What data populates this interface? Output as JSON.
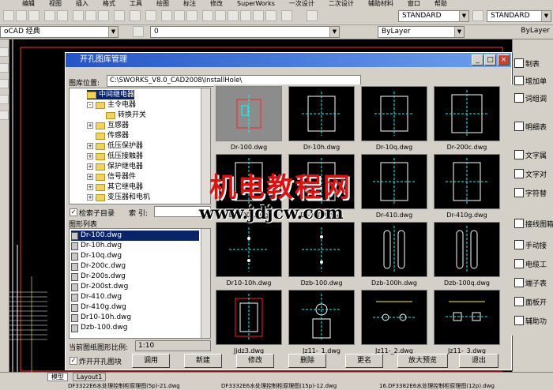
{
  "menubar": {
    "items": [
      "编辑",
      "视图",
      "插入",
      "格式",
      "工具",
      "绘图",
      "标注",
      "修改",
      "SuperWorks",
      "一次设计",
      "二次设计",
      "辅助材料",
      "窗口",
      "帮助"
    ]
  },
  "toolbar": {
    "style1": "STANDARD",
    "style2": "STANDARD"
  },
  "toolbar2": {
    "workspace": "oCAD 经典",
    "layer": "0",
    "color": "ByLayer",
    "linetype": "ByLayer"
  },
  "dialog": {
    "title": "开孔图库管理",
    "path_label": "图库位置:",
    "path_value": "C:\\SWORKS_V8.0_CAD2008\\InstallHole\\",
    "tree": [
      {
        "label": "中间继电器",
        "level": 1,
        "expander": "",
        "selected": true
      },
      {
        "label": "主令电器",
        "level": 1,
        "expander": "-",
        "selected": false
      },
      {
        "label": "转换开关",
        "level": 2,
        "expander": "",
        "selected": false
      },
      {
        "label": "互感器",
        "level": 1,
        "expander": "+",
        "selected": false
      },
      {
        "label": "传感器",
        "level": 1,
        "expander": "",
        "selected": false
      },
      {
        "label": "低压保护器",
        "level": 1,
        "expander": "+",
        "selected": false
      },
      {
        "label": "低压接触器",
        "level": 1,
        "expander": "+",
        "selected": false
      },
      {
        "label": "保护继电器",
        "level": 1,
        "expander": "+",
        "selected": false
      },
      {
        "label": "信号器件",
        "level": 1,
        "expander": "+",
        "selected": false
      },
      {
        "label": "其它继电器",
        "level": 1,
        "expander": "+",
        "selected": false
      },
      {
        "label": "变压器和电机",
        "level": 1,
        "expander": "+",
        "selected": false
      }
    ],
    "search_sub_label": "检索子目录",
    "search_label": "索 引:",
    "search_value": "",
    "filelist_title": "图形列表",
    "files": [
      "Dr-100.dwg",
      "Dr-10h.dwg",
      "Dr-10q.dwg",
      "Dr-200c.dwg",
      "Dr-200s.dwg",
      "Dr-200st.dwg",
      "Dr-410.dwg",
      "Dr-410g.dwg",
      "Dr10-10h.dwg",
      "Dzb-100.dwg"
    ],
    "scale_label": "当前图纸图形比例:",
    "scale_value": "1:10",
    "thumbs": [
      "Dr-100.dwg",
      "Dr-10h.dwg",
      "Dr-10q.dwg",
      "Dr-200c.dwg",
      "Dr-200s.dwg",
      "Dr-200st.dwg",
      "Dr-410.dwg",
      "Dr-410g.dwg",
      "Dr10-10h.dwg",
      "Dzb-100.dwg",
      "Dzb-100h.dwg",
      "Dzb-100q.dwg",
      "Jjdz3.dwg",
      "Jz11-_1.dwg",
      "Jz11-_2.dwg",
      "Jz11-_3.dwg"
    ],
    "explode_label": "炸开开孔图块",
    "buttons": {
      "use": "调用",
      "new": "新建",
      "modify": "修改",
      "delete": "删除",
      "rename": "更名",
      "zoom": "放大预览",
      "exit": "退出"
    }
  },
  "watermark": {
    "line1": "机电教程网",
    "line2": "www.jdjcw.com"
  },
  "right_palette": [
    "制表",
    "增加单",
    "词组调",
    "明细表",
    "文字属",
    "文字对",
    "字符替",
    "接线图箱",
    "手动接",
    "电缆工",
    "端子表",
    "面板开",
    "辅助功"
  ],
  "status": {
    "tab_model": "模型",
    "tab_layout": "Layout1",
    "line1": "DF3322E6水处理控制柜原理图(5p)-21.dwg",
    "line2": "DF3332E6水处理控制柜原理图(15p)-12.dwg",
    "line3": "16.DF3382E6水处理控制柜原理图(12p).dwg"
  }
}
